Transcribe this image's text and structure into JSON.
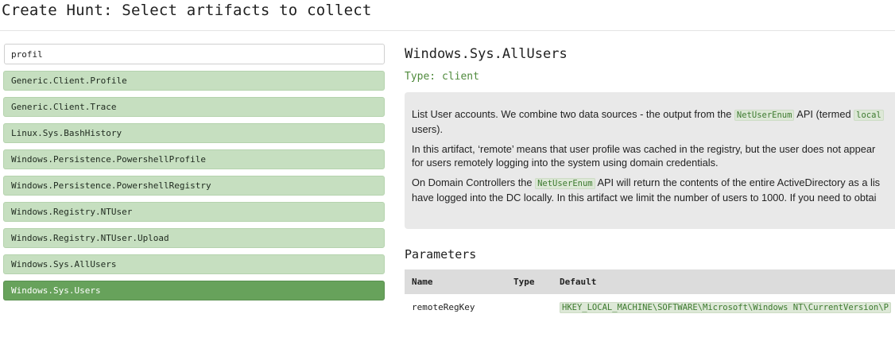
{
  "header": {
    "title": "Create Hunt: Select artifacts to collect"
  },
  "search": {
    "value": "profil"
  },
  "artifacts": [
    {
      "name": "Generic.Client.Profile"
    },
    {
      "name": "Generic.Client.Trace"
    },
    {
      "name": "Linux.Sys.BashHistory"
    },
    {
      "name": "Windows.Persistence.PowershellProfile"
    },
    {
      "name": "Windows.Persistence.PowershellRegistry"
    },
    {
      "name": "Windows.Registry.NTUser"
    },
    {
      "name": "Windows.Registry.NTUser.Upload"
    },
    {
      "name": "Windows.Sys.AllUsers"
    },
    {
      "name": "Windows.Sys.Users"
    }
  ],
  "selected_artifact": "Windows.Sys.Users",
  "detail": {
    "title": "Windows.Sys.AllUsers",
    "type_label": "Type: client",
    "description": {
      "p1_a": "List User accounts. We combine two data sources - the output from the ",
      "p1_code1": "NetUserEnum",
      "p1_b": " API (termed ",
      "p1_code2": "local",
      "p1_c": "users).",
      "p2_a": "In this artifact, ‘remote’ means that user profile was cached in the registry, but the user does not appear",
      "p2_b": "for users remotely logging into the system using domain credentials.",
      "p3_a": "On Domain Controllers the ",
      "p3_code": "NetUserEnum",
      "p3_b": " API will return the contents of the entire ActiveDirectory as a lis",
      "p3_c": "have logged into the DC locally. In this artifact we limit the number of users to 1000. If you need to obtai"
    },
    "parameters_title": "Parameters",
    "param_headers": {
      "name": "Name",
      "type": "Type",
      "default": "Default"
    },
    "params": [
      {
        "name": "remoteRegKey",
        "type": "",
        "default": "HKEY_LOCAL_MACHINE\\SOFTWARE\\Microsoft\\Windows NT\\CurrentVersion\\P"
      }
    ]
  },
  "colors": {
    "item_bg": "#c6dfc0",
    "item_selected_bg": "#67a25b",
    "type_text": "#4f8a3c",
    "desc_bg": "#e9e9e9",
    "code_bg": "#dde8d7"
  }
}
